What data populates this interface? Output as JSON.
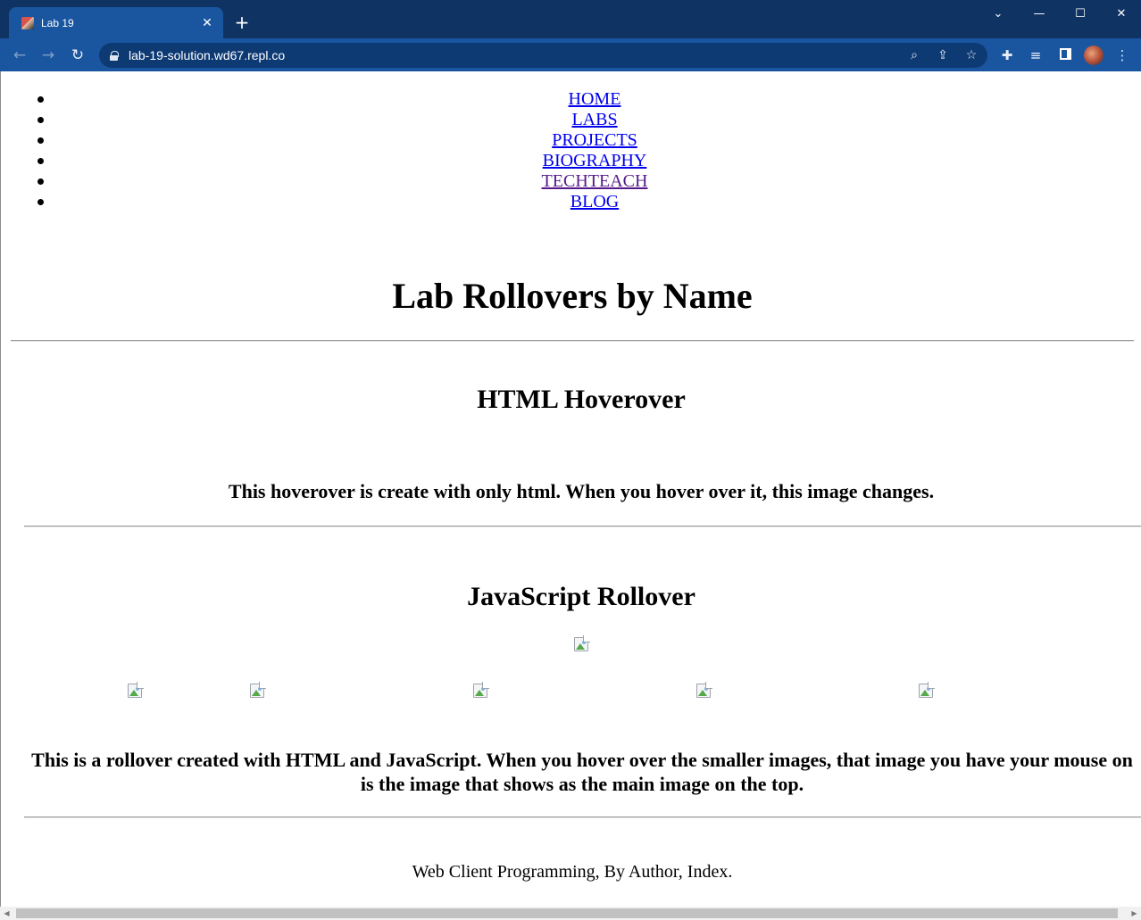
{
  "browser": {
    "tab_title": "Lab 19",
    "tab_close": "✕",
    "new_tab": "+",
    "url": "lab-19-solution.wd67.repl.co",
    "controls": {
      "search_tabs": "⌄",
      "minimize": "—",
      "maximize": "☐",
      "close": "✕"
    },
    "nav": {
      "back": "←",
      "forward": "→",
      "reload": "↻"
    },
    "omnibox_icons": {
      "zoom": "⌕",
      "share": "⇪",
      "star": "☆"
    },
    "toolbar_icons": {
      "extensions": "✚",
      "reading_list": "≡",
      "menu": "⋮"
    }
  },
  "nav": {
    "items": [
      {
        "label": "HOME"
      },
      {
        "label": "LABS"
      },
      {
        "label": "PROJECTS"
      },
      {
        "label": "BIOGRAPHY"
      },
      {
        "label": "TECHTEACH"
      },
      {
        "label": "BLOG"
      }
    ]
  },
  "page": {
    "title": "Lab Rollovers by Name",
    "html_section": {
      "heading": "HTML Hoverover",
      "description": "This hoverover is create with only html. When you hover over it, this image changes."
    },
    "js_section": {
      "heading": "JavaScript Rollover",
      "description": "This is a rollover created with HTML and JavaScript. When you hover over the smaller images, that image you have your mouse on is the image that shows as the main image on the top."
    },
    "footer": "Web Client Programming, By Author, Index."
  },
  "scrollbar": {
    "left_arrow": "◀",
    "right_arrow": "▶"
  }
}
